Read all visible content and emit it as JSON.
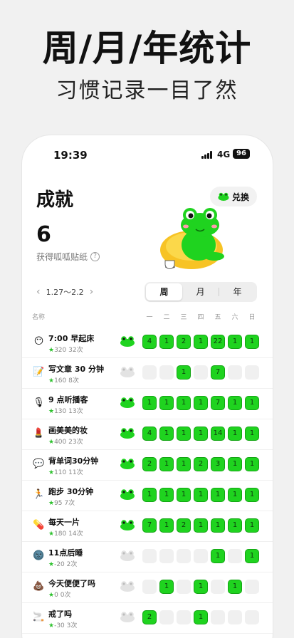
{
  "promo": {
    "title": "周/月/年统计",
    "subtitle": "习惯记录一目了然"
  },
  "status_bar": {
    "time": "19:39",
    "network": "4G",
    "battery": "96"
  },
  "page": {
    "title": "成就",
    "redeem_label": "兑换",
    "stickers_count": "6",
    "stickers_label": "获得呱呱贴纸"
  },
  "date_range": "1.27～2.2",
  "tabs": [
    "周",
    "月",
    "年"
  ],
  "table_header": {
    "name": "名称",
    "days": [
      "一",
      "二",
      "三",
      "四",
      "五",
      "六",
      "日"
    ]
  },
  "colors": {
    "accent_green": "#1fd31f",
    "inactive_cell": "#f0f0f0",
    "star": "#2ec12e"
  },
  "habits": [
    {
      "icon": "sleepy-face-emoji",
      "glyph": "😶",
      "name": "7:00 早起床",
      "stars": "320",
      "count": "32次",
      "active": true,
      "days": [
        "4",
        "1",
        "2",
        "1",
        "22",
        "1",
        "1"
      ]
    },
    {
      "icon": "memo-emoji",
      "glyph": "📝",
      "name": "写文章 30 分钟",
      "stars": "160",
      "count": "8次",
      "active": false,
      "days": [
        null,
        null,
        "1",
        null,
        "7",
        null,
        null
      ]
    },
    {
      "icon": "microphone-emoji",
      "glyph": "🎙",
      "name": "9 点听播客",
      "stars": "130",
      "count": "13次",
      "active": true,
      "days": [
        "1",
        "1",
        "1",
        "1",
        "7",
        "1",
        "1"
      ]
    },
    {
      "icon": "lipstick-emoji",
      "glyph": "💄",
      "name": "画美美的妆",
      "stars": "400",
      "count": "23次",
      "active": true,
      "days": [
        "4",
        "1",
        "1",
        "1",
        "14",
        "1",
        "1"
      ]
    },
    {
      "icon": "speech-bubble-emoji",
      "glyph": "💬",
      "name": "背单词30分钟",
      "stars": "110",
      "count": "11次",
      "active": true,
      "days": [
        "2",
        "1",
        "1",
        "2",
        "3",
        "1",
        "1"
      ]
    },
    {
      "icon": "runner-emoji",
      "glyph": "🏃",
      "name": "跑步 30分钟",
      "stars": "95",
      "count": "7次",
      "active": true,
      "days": [
        "1",
        "1",
        "1",
        "1",
        "1",
        "1",
        "1"
      ]
    },
    {
      "icon": "pill-emoji",
      "glyph": "💊",
      "name": "每天一片",
      "stars": "180",
      "count": "14次",
      "active": true,
      "days": [
        "7",
        "1",
        "2",
        "1",
        "1",
        "1",
        "1"
      ]
    },
    {
      "icon": "dark-face-emoji",
      "glyph": "🌚",
      "name": "11点后睡",
      "stars": "-20",
      "count": "2次",
      "active": false,
      "days": [
        null,
        null,
        null,
        null,
        "1",
        null,
        "1"
      ]
    },
    {
      "icon": "poop-emoji",
      "glyph": "💩",
      "name": "今天便便了吗",
      "stars": "0",
      "count": "0次",
      "active": false,
      "days": [
        null,
        "1",
        null,
        "1",
        null,
        "1",
        null
      ]
    },
    {
      "icon": "cigarette-emoji",
      "glyph": "🚬",
      "name": "戒了吗",
      "stars": "-30",
      "count": "3次",
      "active": false,
      "days": [
        "2",
        null,
        null,
        "1",
        null,
        null,
        null
      ]
    }
  ]
}
